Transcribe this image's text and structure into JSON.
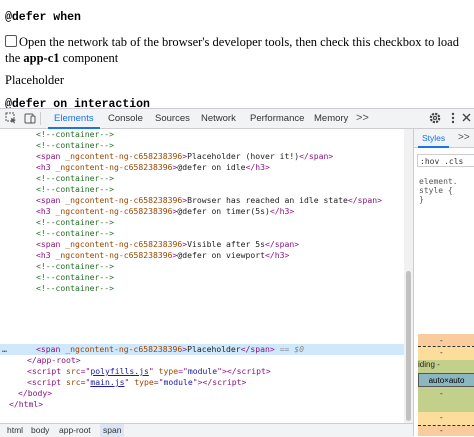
{
  "page": {
    "heading_defer_when": "@defer when",
    "checkbox_text_before": "Open the network tab of the browser's developer tools, then check this checkbox to load the ",
    "checkbox_text_bold": "app-c1",
    "checkbox_text_after": " component",
    "placeholder_text": "Placeholder",
    "heading_defer_interaction": "@defer on interaction"
  },
  "devtools": {
    "tabs": [
      "Elements",
      "Console",
      "Sources",
      "Network",
      "Performance",
      "Memory"
    ],
    "active_tab": "Elements",
    "more_tabs": ">>",
    "breadcrumb": [
      "html",
      "body",
      "app-root",
      "span"
    ],
    "breadcrumb_active": "span",
    "styles_tab": "Styles",
    "styles_more": ">>",
    "filter_text": ":hov .cls",
    "element_style": [
      "element.",
      "style {",
      "}"
    ],
    "box_model": {
      "margin_label": "",
      "border_label": "",
      "padding_label": "iding -",
      "content_size": "auto×auto",
      "dash": "-"
    },
    "selected_suffix": "== $0",
    "selected_dots": "…"
  },
  "elements": {
    "comment_container": "<!--container-->",
    "span_attr": "_ngcontent-ng-c658238396",
    "h3_attr": "_ngcontent-ng-c658238396",
    "placeholder_hover": "Placeholder (hover it!)",
    "defer_on_idle": "@defer on idle",
    "idle_state": "Browser has reached an idle state",
    "defer_on_timer": "@defer on timer(5s)",
    "visible_after": "Visible after 5s",
    "defer_on_viewport": "@defer on viewport",
    "placeholder": "Placeholder",
    "app_root_close": "</app-root>",
    "polyfills_src": "polyfills.js",
    "main_src": "main.js",
    "type_module": "module",
    "body_close": "</body>",
    "html_close": "</html>"
  }
}
